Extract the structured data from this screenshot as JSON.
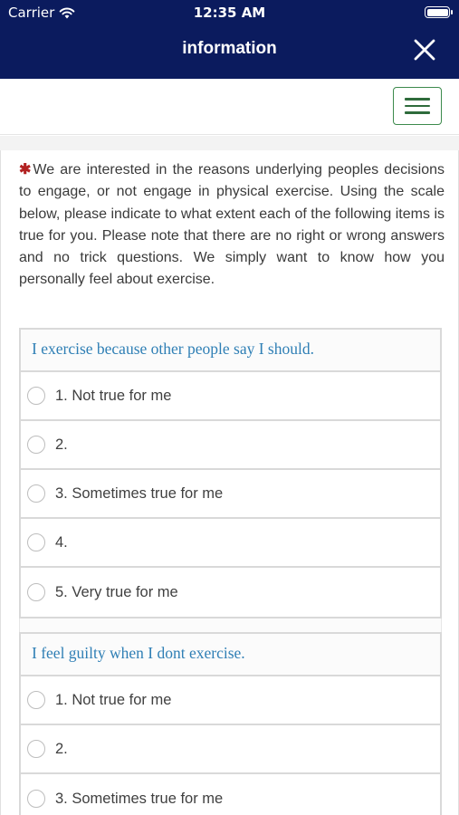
{
  "status_bar": {
    "carrier": "Carrier",
    "time": "12:35 AM"
  },
  "header": {
    "title": "information",
    "close_icon": "close-icon",
    "background": "#0b1b5e"
  },
  "menu": {
    "icon": "hamburger-menu-icon",
    "accent": "#3c8a4c"
  },
  "intro": {
    "required_mark": "✱",
    "text": "We are interested in the reasons underlying peoples decisions to engage, or not engage in physical exercise. Using the scale below, please indicate to what extent each of the following items is true for you. Please note that there are no right or wrong answers and no trick questions. We simply want to know how you personally feel about exercise."
  },
  "questions": [
    {
      "text": "I exercise because other people say I should.",
      "options": [
        "1. Not true for me",
        "2.",
        "3. Sometimes true for me",
        "4.",
        "5. Very true for me"
      ]
    },
    {
      "text": "I feel guilty when I dont exercise.",
      "options": [
        "1. Not true for me",
        "2.",
        "3. Sometimes true for me"
      ]
    }
  ],
  "colors": {
    "question_text": "#2f7fb5",
    "required": "#b22222"
  }
}
